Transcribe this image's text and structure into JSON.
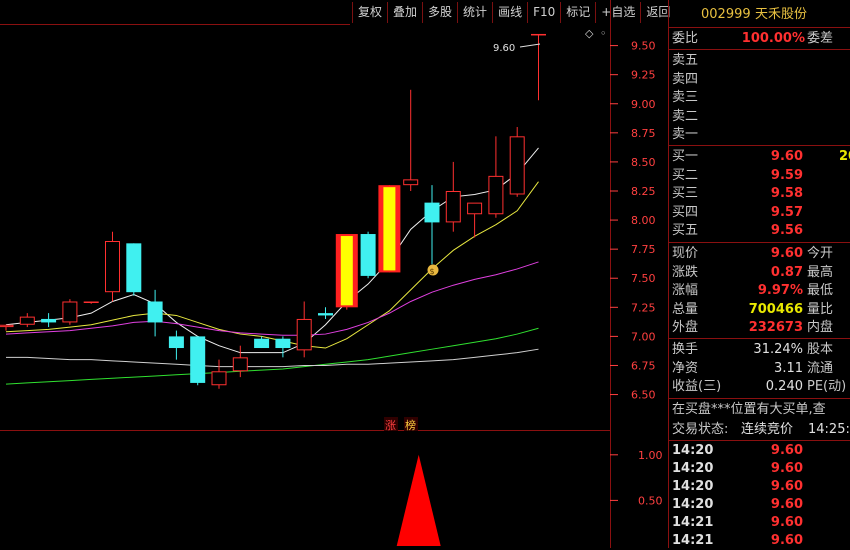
{
  "toolbar": [
    "复权",
    "叠加",
    "多股",
    "统计",
    "画线",
    "F10",
    "标记",
    "+自选",
    "返回"
  ],
  "header": {
    "code": "002999",
    "name": "天禾股份"
  },
  "order_ratio": {
    "label": "委比",
    "value": "100.00%",
    "label2": "委差"
  },
  "sell": [
    {
      "label": "卖五"
    },
    {
      "label": "卖四"
    },
    {
      "label": "卖三"
    },
    {
      "label": "卖二"
    },
    {
      "label": "卖一"
    }
  ],
  "buy": [
    {
      "label": "买一",
      "price": "9.60",
      "vol": "20"
    },
    {
      "label": "买二",
      "price": "9.59"
    },
    {
      "label": "买三",
      "price": "9.58"
    },
    {
      "label": "买四",
      "price": "9.57"
    },
    {
      "label": "买五",
      "price": "9.56"
    }
  ],
  "stats": [
    {
      "l": "现价",
      "v": "9.60",
      "c": "red",
      "l2": "今开"
    },
    {
      "l": "涨跌",
      "v": "0.87",
      "c": "red",
      "l2": "最高"
    },
    {
      "l": "涨幅",
      "v": "9.97%",
      "c": "red",
      "l2": "最低"
    },
    {
      "l": "总量",
      "v": "700466",
      "c": "yellow",
      "l2": "量比"
    },
    {
      "l": "外盘",
      "v": "232673",
      "c": "red",
      "l2": "内盘"
    }
  ],
  "stats2": [
    {
      "l": "换手",
      "v": "31.24%",
      "c": "white",
      "l2": "股本"
    },
    {
      "l": "净资",
      "v": "3.11",
      "c": "white",
      "l2": "流通"
    },
    {
      "l": "收益(三)",
      "v": "0.240",
      "c": "white",
      "l2": "PE(动)"
    }
  ],
  "notice": "在买盘***位置有大买单,查",
  "trade_status": {
    "label": "交易状态:",
    "value": "连续竞价",
    "time": "14:25:"
  },
  "ticks": [
    {
      "t": "14:20",
      "p": "9.60"
    },
    {
      "t": "14:20",
      "p": "9.60"
    },
    {
      "t": "14:20",
      "p": "9.60"
    },
    {
      "t": "14:20",
      "p": "9.60"
    },
    {
      "t": "14:21",
      "p": "9.60"
    },
    {
      "t": "14:21",
      "p": "9.60"
    }
  ],
  "chart_data": {
    "type": "candlestick",
    "price_axis_ticks": [
      "9.50",
      "9.25",
      "9.00",
      "8.75",
      "8.50",
      "8.25",
      "8.00",
      "7.75",
      "7.50",
      "7.25",
      "7.00",
      "6.75",
      "6.50"
    ],
    "ylim": [
      6.35,
      9.72
    ],
    "high_marker": "9.60",
    "volume_axis_ticks": [
      "1.00",
      "0.50"
    ],
    "volume_ylim": [
      0,
      1.25
    ],
    "candles": [
      {
        "o": 7.08,
        "h": 7.1,
        "l": 7.05,
        "c": 7.1
      },
      {
        "o": 7.1,
        "h": 7.2,
        "l": 7.08,
        "c": 7.17
      },
      {
        "o": 7.15,
        "h": 7.2,
        "l": 7.08,
        "c": 7.12
      },
      {
        "o": 7.12,
        "h": 7.32,
        "l": 7.1,
        "c": 7.3
      },
      {
        "o": 7.3,
        "h": 7.3,
        "l": 7.28,
        "c": 7.3
      },
      {
        "o": 7.38,
        "h": 7.9,
        "l": 7.3,
        "c": 7.82
      },
      {
        "o": 7.8,
        "h": 7.8,
        "l": 7.35,
        "c": 7.38
      },
      {
        "o": 7.3,
        "h": 7.4,
        "l": 7.0,
        "c": 7.12
      },
      {
        "o": 7.0,
        "h": 7.05,
        "l": 6.8,
        "c": 6.9
      },
      {
        "o": 7.0,
        "h": 7.0,
        "l": 6.58,
        "c": 6.6
      },
      {
        "o": 6.58,
        "h": 6.8,
        "l": 6.55,
        "c": 6.7
      },
      {
        "o": 6.7,
        "h": 6.92,
        "l": 6.65,
        "c": 6.82
      },
      {
        "o": 6.98,
        "h": 7.0,
        "l": 6.9,
        "c": 6.9
      },
      {
        "o": 6.98,
        "h": 7.0,
        "l": 6.82,
        "c": 6.9
      },
      {
        "o": 6.88,
        "h": 7.3,
        "l": 6.82,
        "c": 7.15
      },
      {
        "o": 7.2,
        "h": 7.25,
        "l": 7.15,
        "c": 7.18
      },
      {
        "o": 7.25,
        "h": 7.88,
        "l": 7.23,
        "c": 7.88
      },
      {
        "o": 7.88,
        "h": 7.9,
        "l": 7.5,
        "c": 7.52
      },
      {
        "o": 7.55,
        "h": 8.3,
        "l": 7.55,
        "c": 8.3
      },
      {
        "o": 8.3,
        "h": 9.12,
        "l": 8.25,
        "c": 8.35
      },
      {
        "o": 8.15,
        "h": 8.3,
        "l": 7.62,
        "c": 7.98
      },
      {
        "o": 7.98,
        "h": 8.5,
        "l": 7.9,
        "c": 8.25
      },
      {
        "o": 8.05,
        "h": 8.12,
        "l": 7.85,
        "c": 8.15
      },
      {
        "o": 8.05,
        "h": 8.72,
        "l": 8.02,
        "c": 8.38
      },
      {
        "o": 8.22,
        "h": 8.8,
        "l": 8.2,
        "c": 8.72
      },
      {
        "o": 9.6,
        "h": 9.6,
        "l": 9.03,
        "c": 9.6
      }
    ],
    "ma_series": [
      {
        "color": "#f0f0f0",
        "values": [
          7.1,
          7.12,
          7.14,
          7.16,
          7.2,
          7.3,
          7.36,
          7.28,
          7.12,
          7.0,
          6.92,
          6.86,
          6.86,
          6.86,
          6.94,
          7.1,
          7.3,
          7.45,
          7.65,
          7.92,
          8.08,
          8.2,
          8.22,
          8.26,
          8.4,
          8.62
        ]
      },
      {
        "color": "#e8e840",
        "values": [
          7.04,
          7.05,
          7.06,
          7.08,
          7.1,
          7.14,
          7.18,
          7.2,
          7.18,
          7.12,
          7.06,
          7.02,
          7.0,
          6.96,
          6.92,
          6.9,
          6.98,
          7.1,
          7.22,
          7.4,
          7.58,
          7.74,
          7.86,
          7.96,
          8.08,
          8.33
        ]
      },
      {
        "color": "#e040e0",
        "values": [
          7.02,
          7.03,
          7.04,
          7.05,
          7.07,
          7.09,
          7.12,
          7.13,
          7.11,
          7.08,
          7.05,
          7.03,
          7.02,
          7.01,
          7.01,
          7.02,
          7.06,
          7.12,
          7.2,
          7.3,
          7.38,
          7.44,
          7.49,
          7.53,
          7.58,
          7.64
        ]
      },
      {
        "color": "#30e030",
        "values": [
          6.59,
          6.6,
          6.61,
          6.62,
          6.63,
          6.64,
          6.65,
          6.66,
          6.67,
          6.68,
          6.69,
          6.7,
          6.71,
          6.72,
          6.74,
          6.76,
          6.78,
          6.8,
          6.83,
          6.86,
          6.89,
          6.92,
          6.95,
          6.98,
          7.02,
          7.07
        ]
      },
      {
        "color": "#d0d0d0",
        "values": [
          6.82,
          6.82,
          6.81,
          6.8,
          6.8,
          6.79,
          6.78,
          6.77,
          6.76,
          6.75,
          6.74,
          6.74,
          6.74,
          6.74,
          6.75,
          6.75,
          6.76,
          6.76,
          6.77,
          6.78,
          6.79,
          6.8,
          6.82,
          6.84,
          6.86,
          6.89
        ]
      }
    ],
    "volume": [
      {
        "index": 19,
        "value": 1.0
      }
    ],
    "badges": [
      "涨",
      "榜"
    ]
  }
}
